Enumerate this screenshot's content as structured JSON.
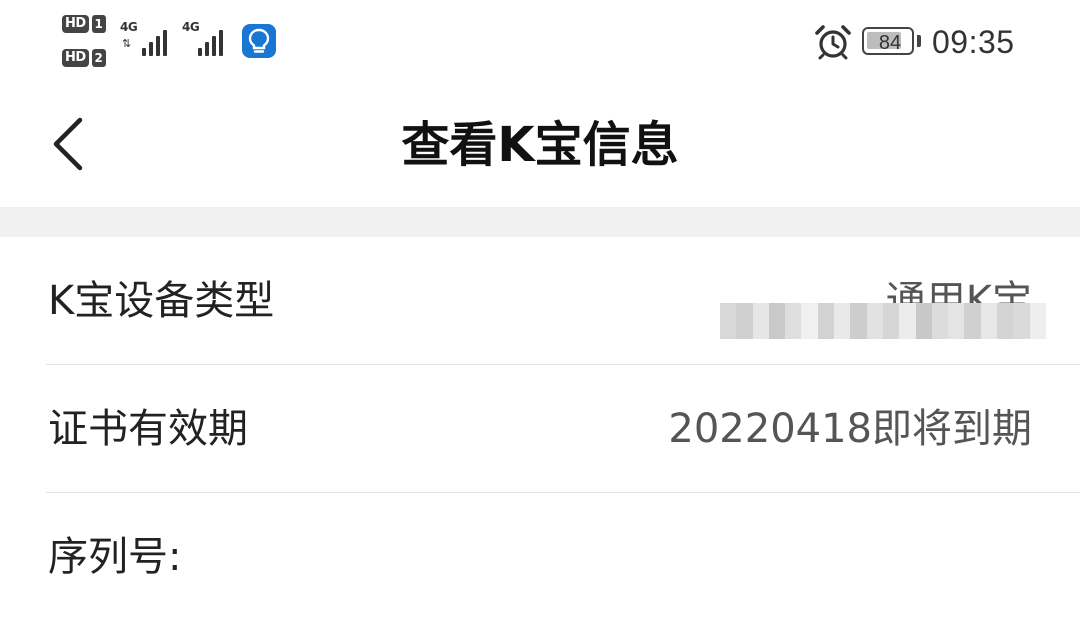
{
  "status_bar": {
    "hd1": "HD",
    "sim1": "1",
    "hd2": "HD",
    "sim2": "2",
    "signal1_tech": "4G",
    "signal2_tech": "4G",
    "battery_level": "84",
    "time": "09:35",
    "icons": [
      "alarm-icon",
      "lightbulb-notification-icon"
    ],
    "accent_color": "#1976d2"
  },
  "header": {
    "title": "查看K宝信息",
    "back_icon": "chevron-left-icon"
  },
  "info_rows": [
    {
      "label": "K宝设备类型",
      "value": "通用K宝"
    },
    {
      "label": "证书有效期",
      "value": "20220418即将到期"
    },
    {
      "label": "序列号:",
      "value_state": "pixelated-redacted"
    }
  ]
}
